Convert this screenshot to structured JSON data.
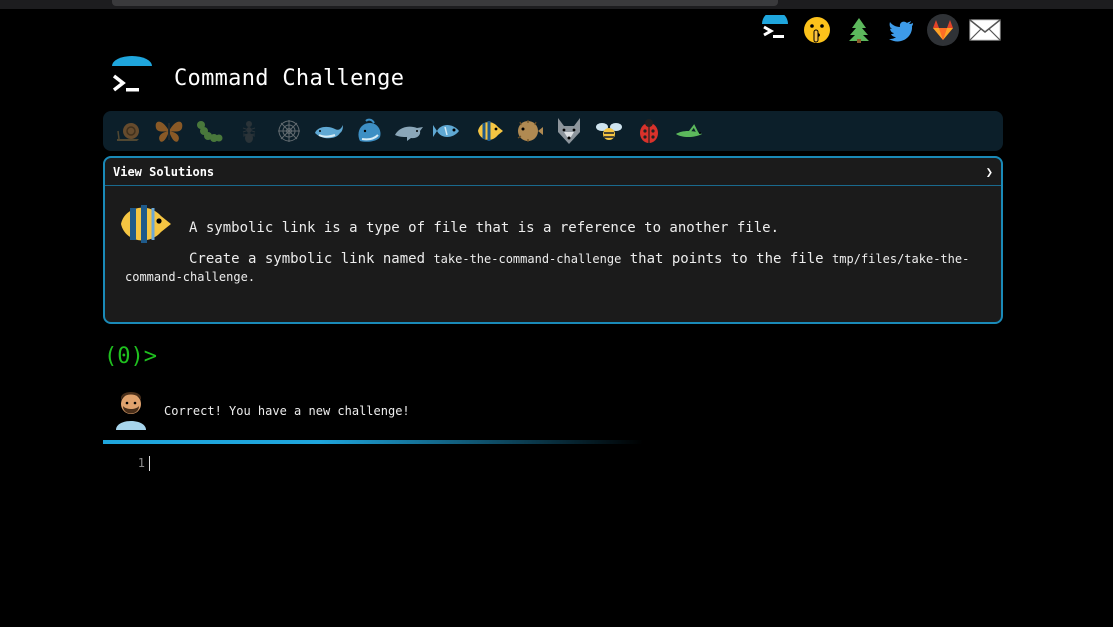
{
  "app": {
    "title": "Command Challenge"
  },
  "top_icons": [
    "terminal-logo-icon",
    "shushing-face-icon",
    "tree-icon",
    "twitter-icon",
    "gitlab-icon",
    "mail-icon"
  ],
  "creatures": [
    "snail",
    "butterfly",
    "caterpillar",
    "ant",
    "spider-web",
    "whale",
    "spouting-whale",
    "dolphin",
    "fish",
    "tropical-fish",
    "blowfish",
    "wolf",
    "bee",
    "ladybug",
    "cricket"
  ],
  "panel": {
    "header_label": "View Solutions",
    "chevron": "❯",
    "intro": "A symbolic link is a type of file that is a reference to another file.",
    "task_prefix": "Create a symbolic link named",
    "link_name": "take-the-command-challenge",
    "task_middle": "that points to the file",
    "target_path": "tmp/files/take-the-command-challenge",
    "task_suffix": "."
  },
  "prompt": {
    "text": "(0)>"
  },
  "result": {
    "message": "Correct! You have a new challenge!"
  },
  "editor": {
    "line_number": "1"
  },
  "colors": {
    "accent": "#1fa6dd",
    "prompt": "#1fc01f",
    "panel_bg": "#1b1b1b",
    "bar_bg": "#0c1f2a"
  }
}
